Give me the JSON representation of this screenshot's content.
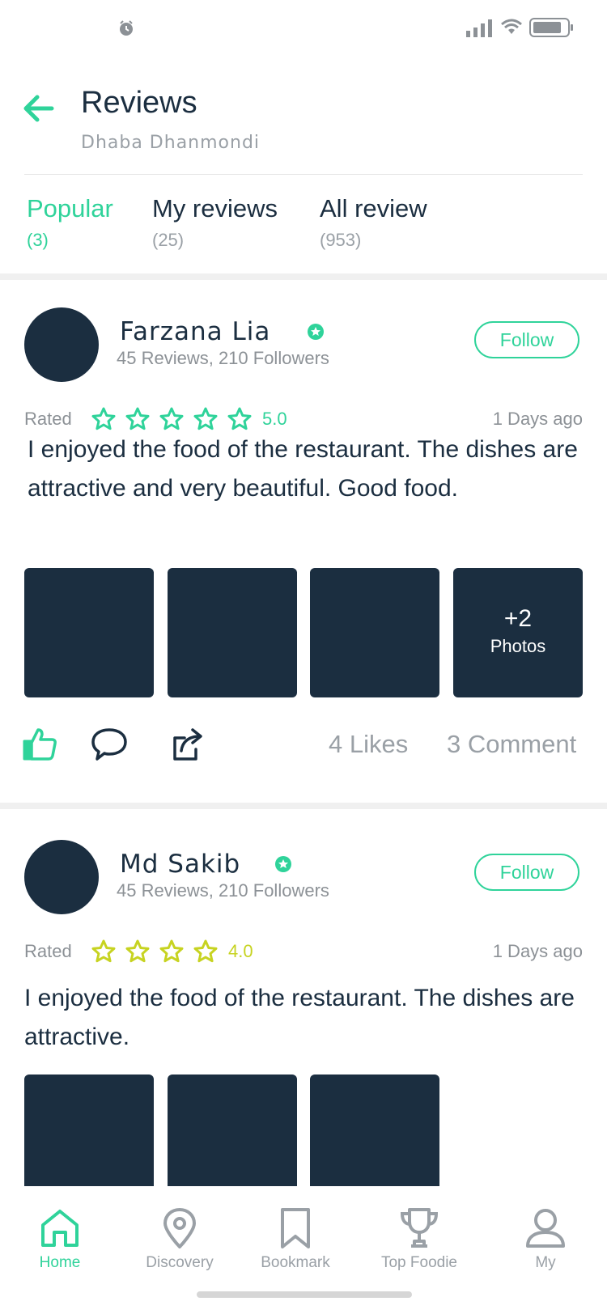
{
  "header": {
    "title": "Reviews",
    "subtitle": "Dhaba Dhanmondi"
  },
  "tabs": [
    {
      "label": "Popular",
      "count": "(3)",
      "active": true
    },
    {
      "label": "My reviews",
      "count": "(25)",
      "active": false
    },
    {
      "label": "All review",
      "count": "(953)",
      "active": false
    }
  ],
  "reviews": [
    {
      "name": "Farzana Lia",
      "meta": "45 Reviews, 210 Followers",
      "follow_label": "Follow",
      "rated_label": "Rated",
      "stars": 5,
      "score": "5.0",
      "star_color": "#2fd39a",
      "time": "1 Days ago",
      "text": "I enjoyed the food of the restaurant. The dishes are attractive and very beautiful. Good food.",
      "more_count": "+2",
      "more_label": "Photos",
      "likes": "4 Likes",
      "comments": "3 Comment"
    },
    {
      "name": "Md Sakib",
      "meta": "45 Reviews, 210 Followers",
      "follow_label": "Follow",
      "rated_label": "Rated",
      "stars": 4,
      "score": "4.0",
      "star_color": "#c7d321",
      "time": "1 Days ago",
      "text": "I enjoyed the food of the restaurant. The dishes are attractive."
    }
  ],
  "nav": [
    {
      "label": "Home",
      "icon": "home-icon",
      "active": true
    },
    {
      "label": "Discovery",
      "icon": "location-pin-icon",
      "active": false
    },
    {
      "label": "Bookmark",
      "icon": "bookmark-icon",
      "active": false
    },
    {
      "label": "Top Foodie",
      "icon": "trophy-icon",
      "active": false
    },
    {
      "label": "My",
      "icon": "user-icon",
      "active": false
    }
  ],
  "colors": {
    "accent": "#2fd39a",
    "dark": "#1b2e40",
    "muted": "#9aa0a6",
    "rating_yellow": "#c7d321"
  }
}
